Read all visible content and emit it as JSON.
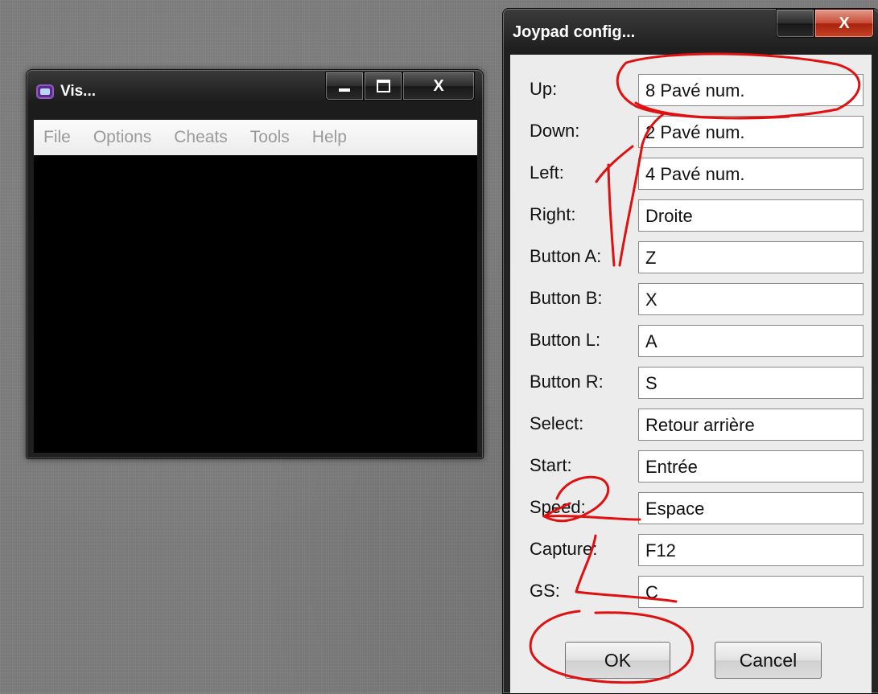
{
  "emulator_window": {
    "title": "Vis...",
    "close_glyph": "X",
    "menu": [
      "File",
      "Options",
      "Cheats",
      "Tools",
      "Help"
    ]
  },
  "dialog": {
    "title": "Joypad config...",
    "close_glyph": "X",
    "rows": [
      {
        "label": "Up:",
        "value": "8 Pavé num."
      },
      {
        "label": "Down:",
        "value": "2 Pavé num."
      },
      {
        "label": "Left:",
        "value": "4 Pavé num."
      },
      {
        "label": "Right:",
        "value": "Droite"
      },
      {
        "label": "Button A:",
        "value": "Z"
      },
      {
        "label": "Button B:",
        "value": "X"
      },
      {
        "label": "Button L:",
        "value": "A"
      },
      {
        "label": "Button R:",
        "value": "S"
      },
      {
        "label": "Select:",
        "value": "Retour arrière"
      },
      {
        "label": "Start:",
        "value": "Entrée"
      },
      {
        "label": "Speed:",
        "value": "Espace"
      },
      {
        "label": "Capture:",
        "value": "F12"
      },
      {
        "label": "GS:",
        "value": "C"
      }
    ],
    "ok_label": "OK",
    "cancel_label": "Cancel"
  },
  "annotations": {
    "number_one": "1",
    "number_two": "2",
    "color": "#e01010"
  }
}
